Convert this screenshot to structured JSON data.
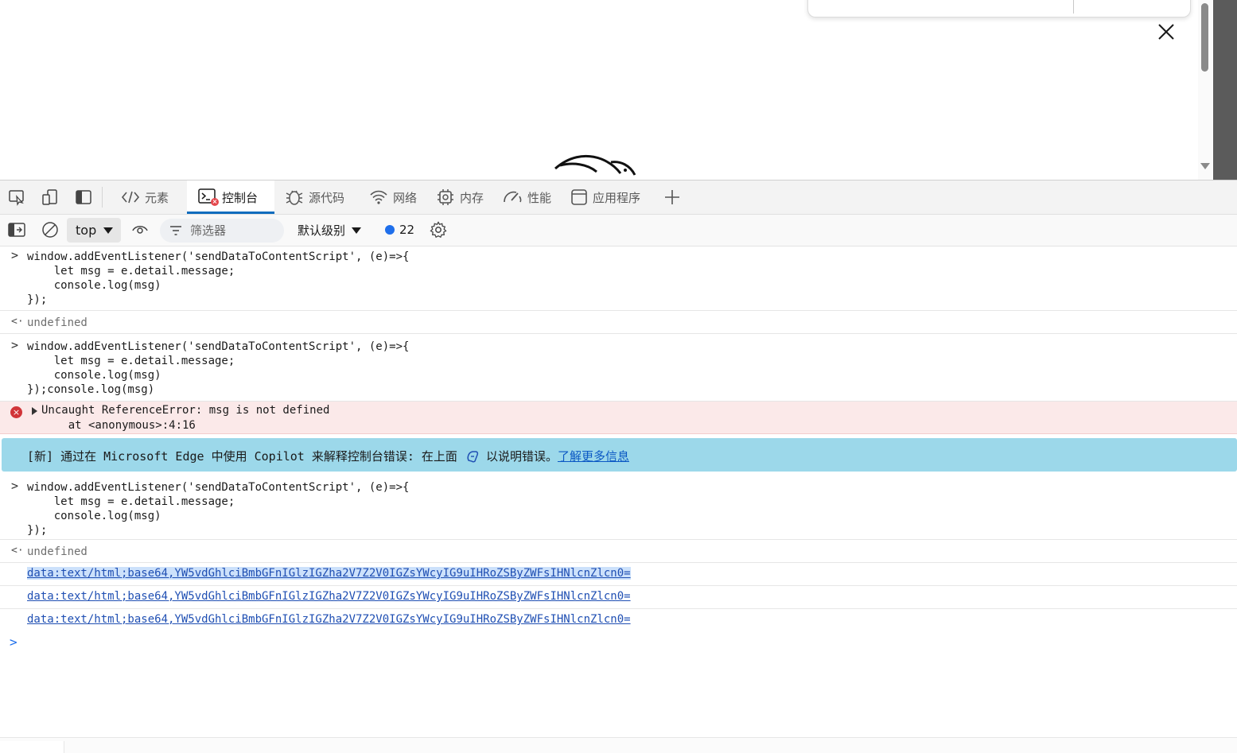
{
  "tabs": [
    {
      "label": "元素",
      "icon": "code-icon"
    },
    {
      "label": "控制台",
      "icon": "console-icon"
    },
    {
      "label": "源代码",
      "icon": "bug-icon"
    },
    {
      "label": "网络",
      "icon": "wifi-icon"
    },
    {
      "label": "内存",
      "icon": "chip-icon"
    },
    {
      "label": "性能",
      "icon": "gauge-icon"
    },
    {
      "label": "应用程序",
      "icon": "window-icon"
    }
  ],
  "active_tab": "控制台",
  "toolbar": {
    "context": "top",
    "filter_placeholder": "筛选器",
    "level": "默认级别",
    "message_count": "22"
  },
  "console": {
    "code_block_1": "window.addEventListener('sendDataToContentScript', (e)=>{\n    let msg = e.detail.message;\n    console.log(msg)\n});",
    "result_1": "undefined",
    "code_block_2": "window.addEventListener('sendDataToContentScript', (e)=>{\n    let msg = e.detail.message;\n    console.log(msg)\n});console.log(msg)",
    "error_message": "Uncaught ReferenceError: msg is not defined",
    "error_location": "    at <anonymous>:4:16",
    "banner_text_before": "[新] 通过在 Microsoft Edge 中使用 Copilot 来解释控制台错误: 在上面",
    "banner_text_after": "以说明错误。",
    "banner_link": "了解更多信息",
    "code_block_3": "window.addEventListener('sendDataToContentScript', (e)=>{\n    let msg = e.detail.message;\n    console.log(msg)\n});",
    "result_2": "undefined",
    "data_links": [
      "data:text/html;base64,YW5vdGhlciBmbGFnIGlzIGZha2V7Z2V0IGZsYWcyIG9uIHRoZSByZWFsIHNlcnZlcn0=",
      "data:text/html;base64,YW5vdGhlciBmbGFnIGlzIGZha2V7Z2V0IGZsYWcyIG9uIHRoZSByZWFsIHNlcnZlcn0=",
      "data:text/html;base64,YW5vdGhlciBmbGFnIGlzIGZha2V7Z2V0IGZsYWcyIG9uIHRoZSByZWFsIHNlcnZlcn0="
    ]
  },
  "colors": {
    "accent": "#0f6cbd",
    "error_bg": "#fbe9e9",
    "banner_bg": "#9cd8ea"
  }
}
